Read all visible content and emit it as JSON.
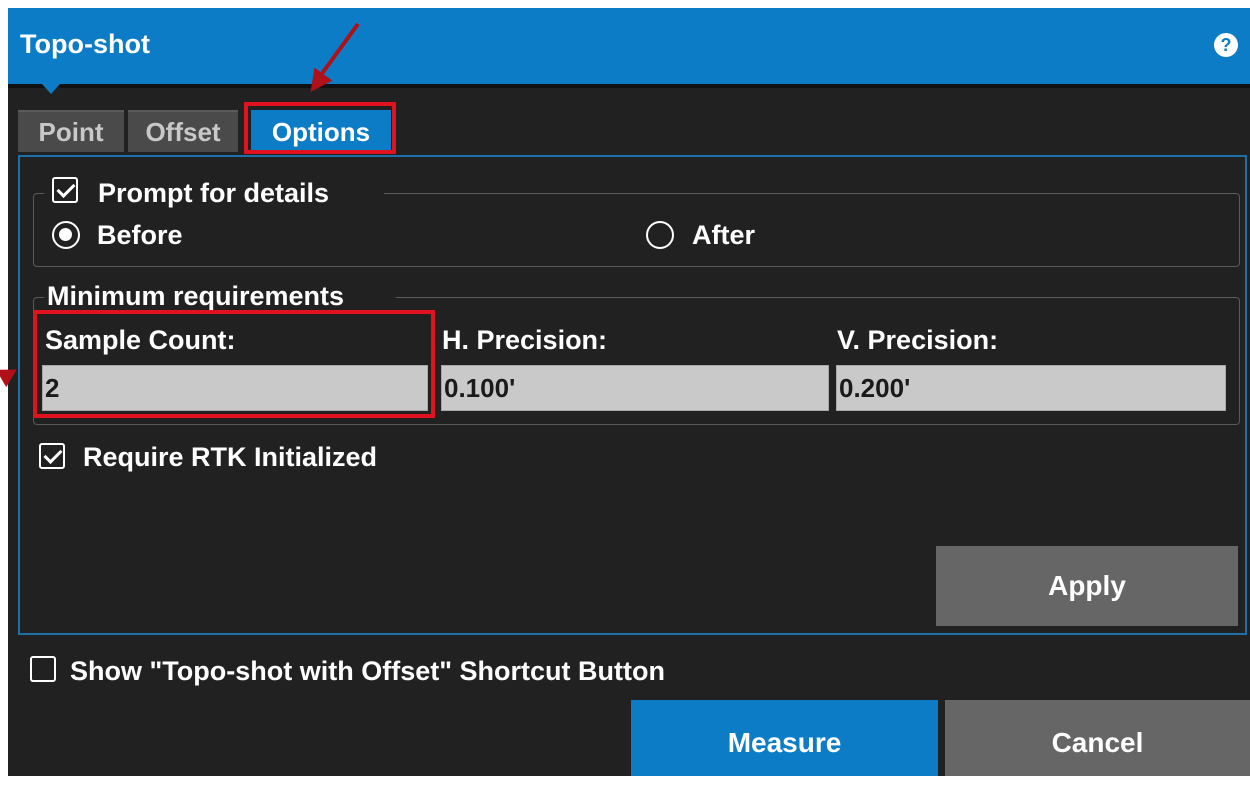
{
  "dialog": {
    "title": "Topo-shot",
    "help_icon": "question-circle-icon"
  },
  "tabs": [
    {
      "label": "Point",
      "active": false
    },
    {
      "label": "Offset",
      "active": false
    },
    {
      "label": "Options",
      "active": true
    }
  ],
  "prompt_group": {
    "checkbox_label": "Prompt for details",
    "checked": true,
    "options": [
      {
        "label": "Before",
        "selected": true
      },
      {
        "label": "After",
        "selected": false
      }
    ]
  },
  "min_requirements": {
    "title": "Minimum requirements",
    "fields": [
      {
        "label": "Sample Count:",
        "value": "2"
      },
      {
        "label": "H. Precision:",
        "value": "0.100'"
      },
      {
        "label": "V. Precision:",
        "value": "0.200'"
      }
    ]
  },
  "rtk": {
    "label": "Require RTK Initialized",
    "checked": true
  },
  "apply_label": "Apply",
  "shortcut": {
    "label": "Show \"Topo-shot with Offset\" Shortcut Button",
    "checked": false
  },
  "footer": {
    "measure_label": "Measure",
    "cancel_label": "Cancel"
  },
  "colors": {
    "accent": "#0b7cc5",
    "background": "#212121",
    "button_gray": "#666666",
    "highlight": "#e0121e"
  }
}
